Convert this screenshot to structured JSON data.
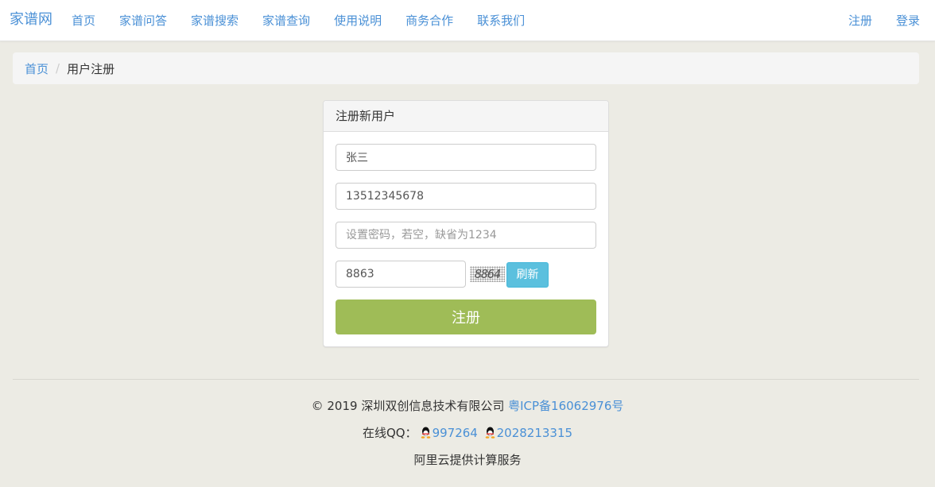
{
  "navbar": {
    "brand": "家谱网",
    "left_items": [
      "首页",
      "家谱问答",
      "家谱搜索",
      "家谱查询",
      "使用说明",
      "商务合作",
      "联系我们"
    ],
    "right_items": [
      "注册",
      "登录"
    ]
  },
  "breadcrumb": {
    "home": "首页",
    "separator": "/",
    "current": "用户注册"
  },
  "form": {
    "title": "注册新用户",
    "name_value": "张三",
    "phone_value": "13512345678",
    "password_placeholder": "设置密码，若空，缺省为1234",
    "code_value": "8863",
    "captcha_text": "8864",
    "refresh_label": "刷新",
    "submit_label": "注册"
  },
  "footer": {
    "copyright": "© 2019 深圳双创信息技术有限公司 ",
    "icp": "粤ICP备16062976号",
    "qq_label": "在线QQ：",
    "qq1": "997264",
    "qq2": "2028213315",
    "hosting": "阿里云提供计算服务"
  },
  "colors": {
    "link": "#4a90d6",
    "refresh": "#5bc0de",
    "submit": "#9fbc57",
    "background": "#ecebe4"
  },
  "icons": [
    "qq-penguin-icon"
  ]
}
